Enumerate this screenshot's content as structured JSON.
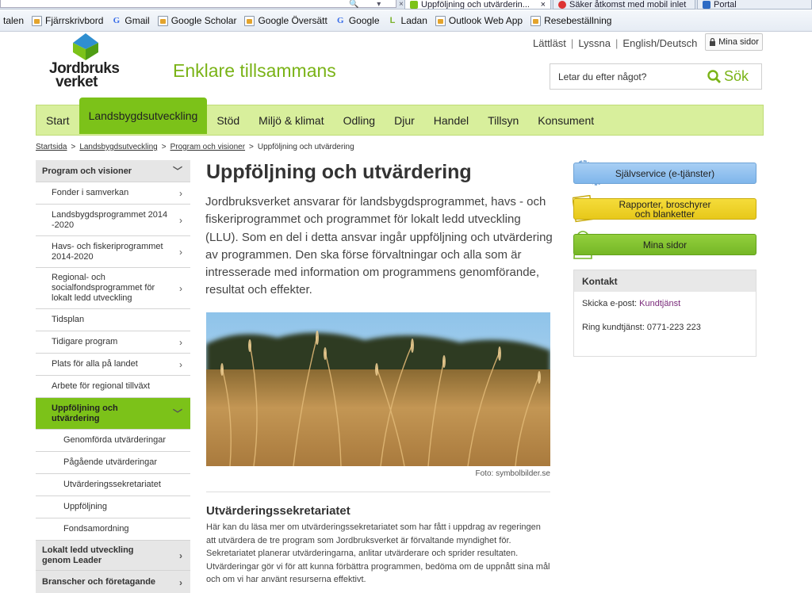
{
  "browser": {
    "tabs": [
      {
        "label": "Uppföljning och utvärderin...",
        "close": "×",
        "active": true
      },
      {
        "label": "Säker åtkomst med mobil inlet",
        "active": false
      },
      {
        "label": "Portal",
        "active": false
      }
    ],
    "bookmarks": [
      {
        "label": "talen",
        "icon": "none"
      },
      {
        "label": "Fjärrskrivbord",
        "icon": "page-icon"
      },
      {
        "label": "Gmail",
        "icon": "google-icon"
      },
      {
        "label": "Google Scholar",
        "icon": "page-icon"
      },
      {
        "label": "Google Översätt",
        "icon": "page-icon"
      },
      {
        "label": "Google",
        "icon": "google-icon"
      },
      {
        "label": "Ladan",
        "icon": "ladan-icon"
      },
      {
        "label": "Outlook Web App",
        "icon": "page-icon"
      },
      {
        "label": "Resebeställning",
        "icon": "page-icon"
      }
    ]
  },
  "header": {
    "util_links": [
      "Lättläst",
      "Lyssna",
      "English/Deutsch"
    ],
    "util_sep": "|",
    "mina_sidor": "Mina sidor",
    "logo_line1": "Jordbruks",
    "logo_line2": "verket",
    "tagline": "Enklare tillsammans",
    "search_placeholder": "Letar du efter något?",
    "search_button": "Sök"
  },
  "nav": {
    "items": [
      {
        "label": "Start",
        "active": false
      },
      {
        "label": "Landsbygdsutveckling",
        "active": true
      },
      {
        "label": "Stöd",
        "active": false
      },
      {
        "label": "Miljö & klimat",
        "active": false
      },
      {
        "label": "Odling",
        "active": false
      },
      {
        "label": "Djur",
        "active": false
      },
      {
        "label": "Handel",
        "active": false
      },
      {
        "label": "Tillsyn",
        "active": false
      },
      {
        "label": "Konsument",
        "active": false
      }
    ]
  },
  "breadcrumb": {
    "items": [
      "Startsida",
      "Landsbygdsutveckling",
      "Program och visioner"
    ],
    "current": "Uppföljning och utvärdering",
    "sep": ">"
  },
  "sidebar": {
    "head": "Program och visioner",
    "items": [
      {
        "label": "Fonder i samverkan",
        "chev": true
      },
      {
        "label": "Landsbygdsprogrammet 2014\n-2020",
        "chev": true
      },
      {
        "label": "Havs- och fiskeriprogrammet\n2014-2020",
        "chev": true
      },
      {
        "label": "Regional- och\nsocialfondsprogrammet för\nlokalt ledd utveckling",
        "chev": true
      },
      {
        "label": "Tidsplan",
        "chev": false
      },
      {
        "label": "Tidigare program",
        "chev": true
      },
      {
        "label": "Plats för alla på landet",
        "chev": true
      },
      {
        "label": "Arbete för regional tillväxt",
        "chev": false
      }
    ],
    "active": "Uppföljning och\nutvärdering",
    "subitems": [
      "Genomförda utvärderingar",
      "Pågående utvärderingar",
      "Utvärderingssekretariatet",
      "Uppföljning",
      "Fondsamordning"
    ],
    "bottom": [
      "Lokalt ledd utveckling\ngenom Leader",
      "Branscher och företagande"
    ]
  },
  "main": {
    "title": "Uppföljning och utvärdering",
    "lead": "Jordbruksverket ansvarar för landsbygdsprogrammet, havs - och fiskeriprogrammet och programmet för lokalt ledd utveckling (LLU). Som en del i detta ansvar ingår uppföljning och utvärdering av programmen. Den ska förse förvaltningar och alla som är intresserade med information om programmens genomförande, resultat och effekter.",
    "photo_credit": "Foto: symbolbilder.se",
    "h2": "Utvärderingssekretariatet",
    "body": "Här kan du läsa mer om utvärderingssekretariatet som har fått i uppdrag av regeringen att utvärdera de tre program som Jordbruksverket är förvaltande myndighet för. Sekretariatet planerar utvärderingarna, anlitar utvärderare och sprider resultaten. Utvärderingar gör vi för att kunna förbättra programmen, bedöma om de uppnått sina mål och om vi har använt resurserna effektivt."
  },
  "right": {
    "btn_self": "Självservice (e-tjänster)",
    "btn_reports": "Rapporter, broschyrer\noch blanketter",
    "btn_mina": "Mina sidor",
    "contact_head": "Kontakt",
    "email_label": "Skicka e-post:",
    "email_link": "Kundtjänst",
    "phone": "Ring kundtjänst: 0771-223 223"
  },
  "colors": {
    "accent_green": "#7cc219",
    "nav_bg": "#d8ef9c",
    "tagline": "#7ab317",
    "link_purple": "#7a2a7a"
  }
}
